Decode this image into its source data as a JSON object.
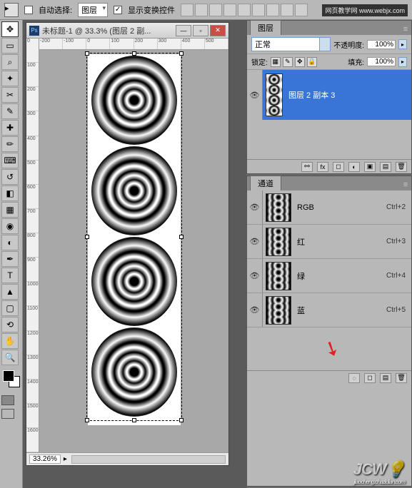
{
  "options_bar": {
    "auto_select_label": "自动选择:",
    "auto_select_checked": false,
    "target_dropdown": "图层",
    "show_transform_label": "显示变换控件",
    "show_transform_checked": true,
    "watermark": "网页教学网\nwww.webjx.com"
  },
  "document": {
    "title": "未标题-1 @ 33.3% (图层 2 副...",
    "zoom": "33.26%",
    "ruler_h": [
      "-200",
      "-100",
      "0",
      "100",
      "200",
      "300",
      "400",
      "500"
    ],
    "ruler_v": [
      "0",
      "100",
      "200",
      "300",
      "400",
      "500",
      "600",
      "700",
      "800",
      "900",
      "1000",
      "1100",
      "1200",
      "1300",
      "1400",
      "1500",
      "1600"
    ]
  },
  "layers_panel": {
    "tab": "图层",
    "blend_mode": "正常",
    "opacity_label": "不透明度:",
    "opacity_value": "100%",
    "lock_label": "锁定:",
    "fill_label": "填充:",
    "fill_value": "100%",
    "layer": {
      "name": "图层 2 副本 3"
    }
  },
  "channels_panel": {
    "tab": "通道",
    "channels": [
      {
        "name": "RGB",
        "shortcut": "Ctrl+2"
      },
      {
        "name": "红",
        "shortcut": "Ctrl+3"
      },
      {
        "name": "绿",
        "shortcut": "Ctrl+4"
      },
      {
        "name": "蓝",
        "shortcut": "Ctrl+5"
      }
    ]
  },
  "footer_watermark": "JCW",
  "footer_watermark_sub": "jiaocheng.chazidian.com"
}
